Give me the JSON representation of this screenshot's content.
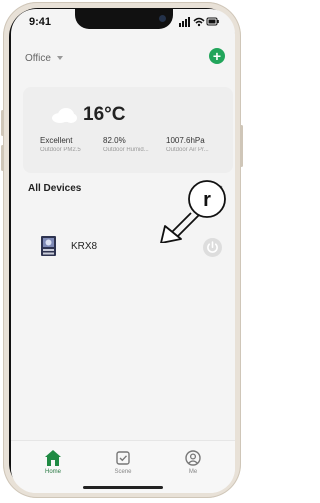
{
  "status_bar": {
    "time": "9:41"
  },
  "header": {
    "home_name": "Office",
    "add_icon": "plus-icon"
  },
  "weather": {
    "icon": "cloud-icon",
    "temperature": "16°C",
    "stats": [
      {
        "value": "Excellent",
        "label": "Outdoor PM2.5"
      },
      {
        "value": "82.0%",
        "label": "Outdoor Humid..."
      },
      {
        "value": "1007.6hPa",
        "label": "Outdoor Air Pr..."
      }
    ]
  },
  "devices": {
    "section_title": "All Devices",
    "items": [
      {
        "name": "KRX8",
        "icon": "device-icon",
        "power_icon": "power-icon"
      }
    ]
  },
  "annotation": {
    "letter": "r"
  },
  "tabs": [
    {
      "label": "Home",
      "icon": "home-icon",
      "active": true
    },
    {
      "label": "Scene",
      "icon": "scene-icon",
      "active": false
    },
    {
      "label": "Me",
      "icon": "profile-icon",
      "active": false
    }
  ],
  "colors": {
    "accent": "#22a55b",
    "home_tab": "#1f8a43"
  }
}
